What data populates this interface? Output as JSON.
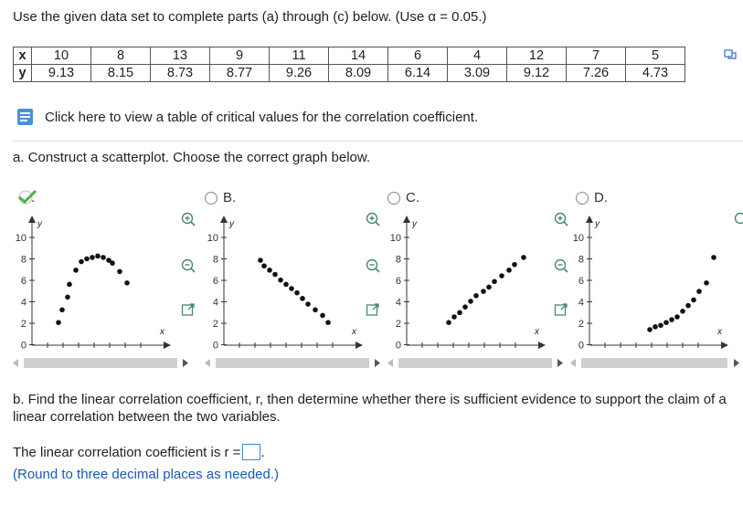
{
  "intro": "Use the given data set to complete parts (a) through (c) below. (Use α = 0.05.)",
  "table": {
    "row_x_label": "x",
    "row_y_label": "y",
    "x": [
      "10",
      "8",
      "13",
      "9",
      "11",
      "14",
      "6",
      "4",
      "12",
      "7",
      "5"
    ],
    "y": [
      "9.13",
      "8.15",
      "8.73",
      "8.77",
      "9.26",
      "8.09",
      "6.14",
      "3.09",
      "9.12",
      "7.26",
      "4.73"
    ]
  },
  "link_text": "Click here to view a table of critical values for the correlation coefficient.",
  "part_a": "a. Construct a scatterplot. Choose the correct graph below.",
  "options": [
    {
      "label": "A.",
      "selected": true,
      "trend": "quadratic"
    },
    {
      "label": "B.",
      "selected": false,
      "trend": "decreasing"
    },
    {
      "label": "C.",
      "selected": false,
      "trend": "increasing"
    },
    {
      "label": "D.",
      "selected": false,
      "trend": "increasing-curve"
    }
  ],
  "graph_axes": {
    "ylabel": "y",
    "xlabel": "x",
    "yticks": [
      "10",
      "8",
      "6",
      "4",
      "2",
      "0"
    ]
  },
  "part_b": "b. Find the linear correlation coefficient, r, then determine whether there is sufficient evidence to support the claim of a linear correlation between the two variables.",
  "answer": {
    "prefix": "The linear correlation coefficient is r =",
    "suffix": ".",
    "hint": "(Round to three decimal places as needed.)",
    "value": ""
  },
  "colors": {
    "accent": "#1a59b2",
    "check": "#4caf50",
    "scroll": "#cfcfcf"
  }
}
